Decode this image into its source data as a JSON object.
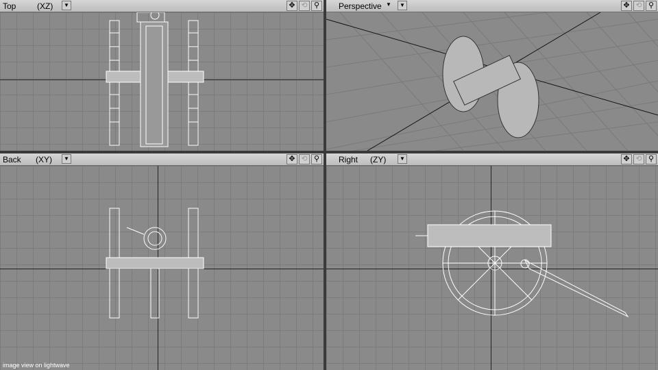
{
  "viewports": {
    "top": {
      "title": "Top",
      "axis": "(XZ)",
      "dropdown_icon": "chevron-down-icon"
    },
    "persp": {
      "title": "Perspective",
      "dropdown_icon": "chevron-down-icon"
    },
    "back": {
      "title": "Back",
      "axis": "(XY)",
      "dropdown_icon": "chevron-down-icon"
    },
    "right": {
      "title": "Right",
      "axis": "(ZY)",
      "dropdown_icon": "chevron-down-icon"
    }
  },
  "tools": {
    "move": "✥",
    "rotate": "⟲",
    "zoom": "⚲"
  },
  "caption": "image view on lightwave",
  "colors": {
    "grid": "#8a8a8a",
    "header": "#c8c8c8",
    "wire": "#ffffff"
  }
}
